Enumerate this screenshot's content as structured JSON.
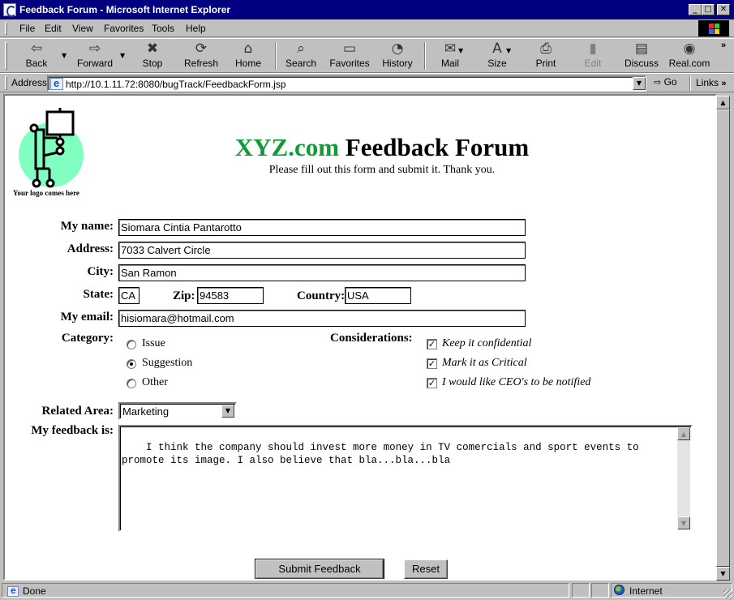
{
  "window": {
    "title": "Feedback Forum - Microsoft Internet Explorer",
    "min_glyph": "_",
    "max_glyph": "□",
    "close_glyph": "✕"
  },
  "menu": {
    "items": [
      "File",
      "Edit",
      "View",
      "Favorites",
      "Tools",
      "Help"
    ]
  },
  "toolbar": {
    "back": "Back",
    "forward": "Forward",
    "stop": "Stop",
    "refresh": "Refresh",
    "home": "Home",
    "search": "Search",
    "favorites": "Favorites",
    "history": "History",
    "mail": "Mail",
    "size": "Size",
    "print": "Print",
    "edit": "Edit",
    "discuss": "Discuss",
    "realcom": "Real.com"
  },
  "address": {
    "label": "Address",
    "url": "http://10.1.11.72:8080/bugTrack/FeedbackForm.jsp",
    "go": "Go",
    "links": "Links"
  },
  "page": {
    "logo_caption": "Your logo comes here",
    "brand": "XYZ.com",
    "title_rest": " Feedback Forum",
    "subtitle": "Please fill out this form and submit it. Thank you."
  },
  "form": {
    "name_label": "My name:",
    "name_value": "Siomara Cintia Pantarotto",
    "address_label": "Address:",
    "address_value": "7033 Calvert Circle",
    "city_label": "City:",
    "city_value": "San Ramon",
    "state_label": "State:",
    "state_value": "CA",
    "zip_label": "Zip:",
    "zip_value": "94583",
    "country_label": "Country:",
    "country_value": "USA",
    "email_label": "My email:",
    "email_value": "hisiomara@hotmail.com",
    "category_label": "Category:",
    "categories": [
      {
        "label": "Issue",
        "selected": false
      },
      {
        "label": "Suggestion",
        "selected": true
      },
      {
        "label": "Other",
        "selected": false
      }
    ],
    "considerations_label": "Considerations:",
    "considerations": [
      {
        "label": "Keep it confidential",
        "checked": true
      },
      {
        "label": "Mark it as Critical",
        "checked": true
      },
      {
        "label": "I would like CEO's to be notified",
        "checked": true
      }
    ],
    "area_label": "Related Area:",
    "area_value": "Marketing",
    "feedback_label": "My feedback is:",
    "feedback_value": "I think the company should invest more money in TV comercials and sport events to\npromote its image. I also believe that bla...bla...bla",
    "submit": "Submit Feedback",
    "reset": "Reset"
  },
  "status": {
    "text": "Done",
    "zone": "Internet"
  },
  "colors": {
    "title_bar": "#000080",
    "brand_green": "#139a3b",
    "logo_circle": "#80ffc0"
  }
}
